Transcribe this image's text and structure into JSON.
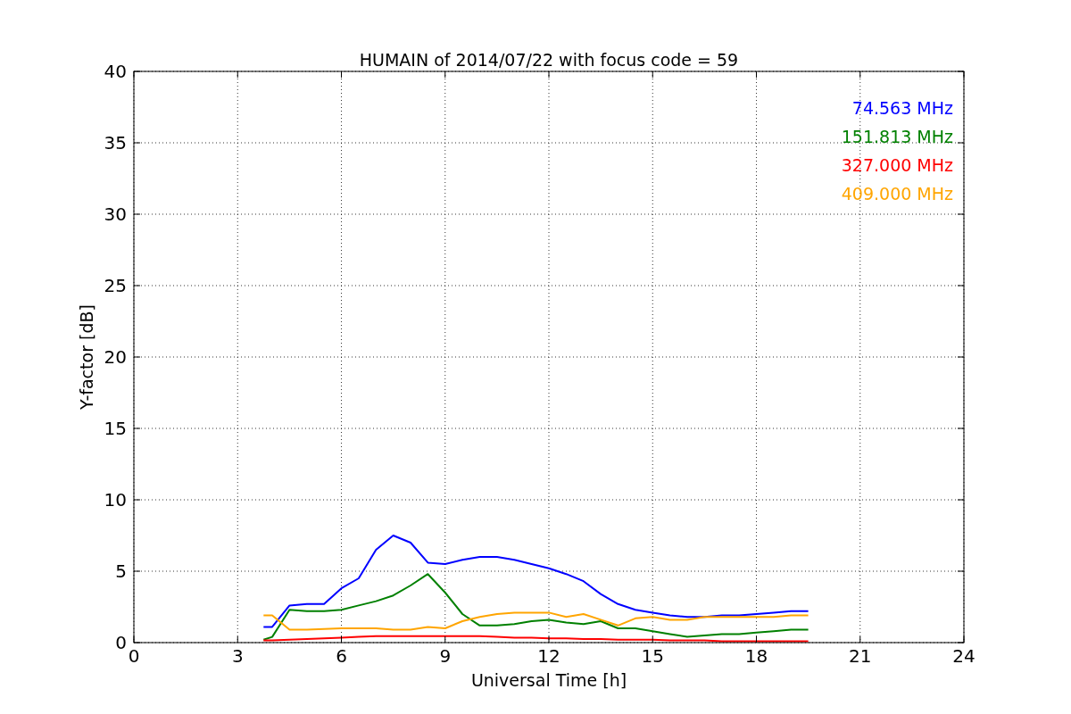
{
  "chart_data": {
    "type": "line",
    "title": "HUMAIN of 2014/07/22 with focus code = 59",
    "xlabel": "Universal Time [h]",
    "ylabel": "Y-factor [dB]",
    "x": [
      3.75,
      4,
      4.5,
      5,
      5.5,
      6,
      6.5,
      7,
      7.5,
      8,
      8.5,
      9,
      9.5,
      10,
      10.5,
      11,
      11.5,
      12,
      12.5,
      13,
      13.5,
      14,
      14.5,
      15,
      15.5,
      16,
      16.5,
      17,
      17.5,
      18,
      18.5,
      19,
      19.5
    ],
    "series": [
      {
        "name": "74.563 MHz",
        "color": "#0000ff",
        "values": [
          1.1,
          1.1,
          2.6,
          2.7,
          2.7,
          3.8,
          4.5,
          6.5,
          7.5,
          7,
          5.6,
          5.5,
          5.8,
          6,
          6,
          5.8,
          5.5,
          5.2,
          4.8,
          4.3,
          3.4,
          2.7,
          2.3,
          2.1,
          1.9,
          1.8,
          1.8,
          1.9,
          1.9,
          2.0,
          2.1,
          2.2,
          2.2
        ]
      },
      {
        "name": "151.813 MHz",
        "color": "#008000",
        "values": [
          0.2,
          0.4,
          2.3,
          2.2,
          2.2,
          2.3,
          2.6,
          2.9,
          3.3,
          4.0,
          4.8,
          3.5,
          2.0,
          1.2,
          1.2,
          1.3,
          1.5,
          1.6,
          1.4,
          1.3,
          1.5,
          1.0,
          1.0,
          0.8,
          0.6,
          0.4,
          0.5,
          0.6,
          0.6,
          0.7,
          0.8,
          0.9,
          0.9
        ]
      },
      {
        "name": "327.000 MHz",
        "color": "#ff0000",
        "values": [
          0.15,
          0.15,
          0.2,
          0.25,
          0.3,
          0.35,
          0.4,
          0.45,
          0.45,
          0.45,
          0.45,
          0.45,
          0.45,
          0.45,
          0.4,
          0.35,
          0.35,
          0.3,
          0.3,
          0.25,
          0.25,
          0.2,
          0.2,
          0.2,
          0.15,
          0.15,
          0.15,
          0.1,
          0.1,
          0.1,
          0.1,
          0.1,
          0.1
        ]
      },
      {
        "name": "409.000 MHz",
        "color": "#ffa500",
        "values": [
          1.9,
          1.9,
          0.9,
          0.9,
          0.95,
          1.0,
          1.0,
          1.0,
          0.9,
          0.9,
          1.1,
          1.0,
          1.5,
          1.8,
          2.0,
          2.1,
          2.1,
          2.1,
          1.8,
          2.0,
          1.6,
          1.2,
          1.7,
          1.8,
          1.6,
          1.6,
          1.8,
          1.8,
          1.8,
          1.8,
          1.8,
          1.9,
          1.9
        ]
      }
    ],
    "grid": true,
    "xlim": [
      0,
      24
    ],
    "ylim": [
      0,
      40
    ],
    "xticks": [
      0,
      3,
      6,
      9,
      12,
      15,
      18,
      21,
      24
    ],
    "yticks": [
      0,
      5,
      10,
      15,
      20,
      25,
      30,
      35,
      40
    ]
  }
}
